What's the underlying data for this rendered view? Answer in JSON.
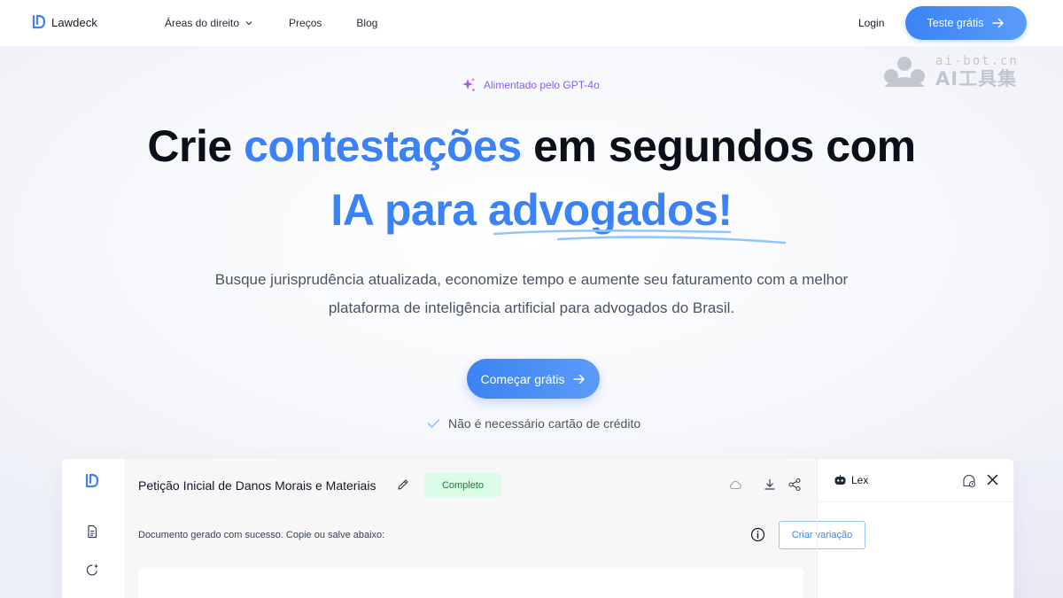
{
  "nav": {
    "brand": "Lawdeck",
    "links": [
      "Áreas do direito",
      "Preços",
      "Blog"
    ],
    "login": "Login",
    "trial_button": "Teste grátis"
  },
  "watermark": {
    "line1": "ai-bot.cn",
    "line2": "AI工具集"
  },
  "hero": {
    "badge": "Alimentado pelo GPT-4o",
    "title_l1_a": "Crie ",
    "title_l1_b": "contestações",
    "title_l1_c": " em segundos com",
    "title_l2": "IA para advogados!",
    "subtitle_l1": "Busque jurisprudência atualizada, economize tempo e aumente seu faturamento com a melhor",
    "subtitle_l2": "plataforma de inteligência artificial para advogados do Brasil.",
    "cta": "Começar grátis",
    "note": "Não é necessário cartão de crédito"
  },
  "app": {
    "doc_title": "Petição Inicial de Danos Morais e Materiais",
    "status": "Completo",
    "message": "Documento gerado com sucesso. Copie ou salve abaixo:",
    "variation_button": "Criar variação",
    "chat_name": "Lex"
  },
  "colors": {
    "accent": "#3b82f6",
    "badge": "#8b5cf6",
    "status_bg": "#dcfce7",
    "status_text": "#15803d"
  }
}
